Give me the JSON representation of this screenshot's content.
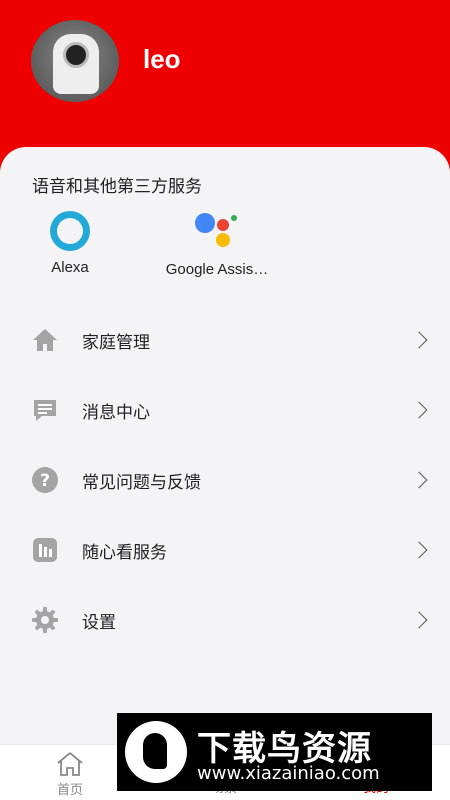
{
  "profile": {
    "username": "leo"
  },
  "services": {
    "title": "语音和其他第三方服务",
    "items": [
      {
        "label": "Alexa",
        "icon": "alexa-icon"
      },
      {
        "label": "Google Assis…",
        "icon": "google-assistant-icon"
      }
    ]
  },
  "menu": [
    {
      "label": "家庭管理",
      "icon": "home-icon"
    },
    {
      "label": "消息中心",
      "icon": "message-icon"
    },
    {
      "label": "常见问题与反馈",
      "icon": "help-icon"
    },
    {
      "label": "随心看服务",
      "icon": "chart-icon"
    },
    {
      "label": "设置",
      "icon": "gear-icon"
    }
  ],
  "tabs": [
    {
      "label": "首页",
      "icon": "home-icon"
    },
    {
      "label": "场景",
      "icon": "scene-icon"
    },
    {
      "label": "我的",
      "icon": "profile-icon",
      "active": true
    }
  ],
  "watermark": {
    "title": "下载鸟资源",
    "url": "www.xiazainiao.com"
  },
  "colors": {
    "header": "#ee0000",
    "accent": "#e00000",
    "icon_gray": "#a4a4a4",
    "alexa": "#22a9d8"
  }
}
